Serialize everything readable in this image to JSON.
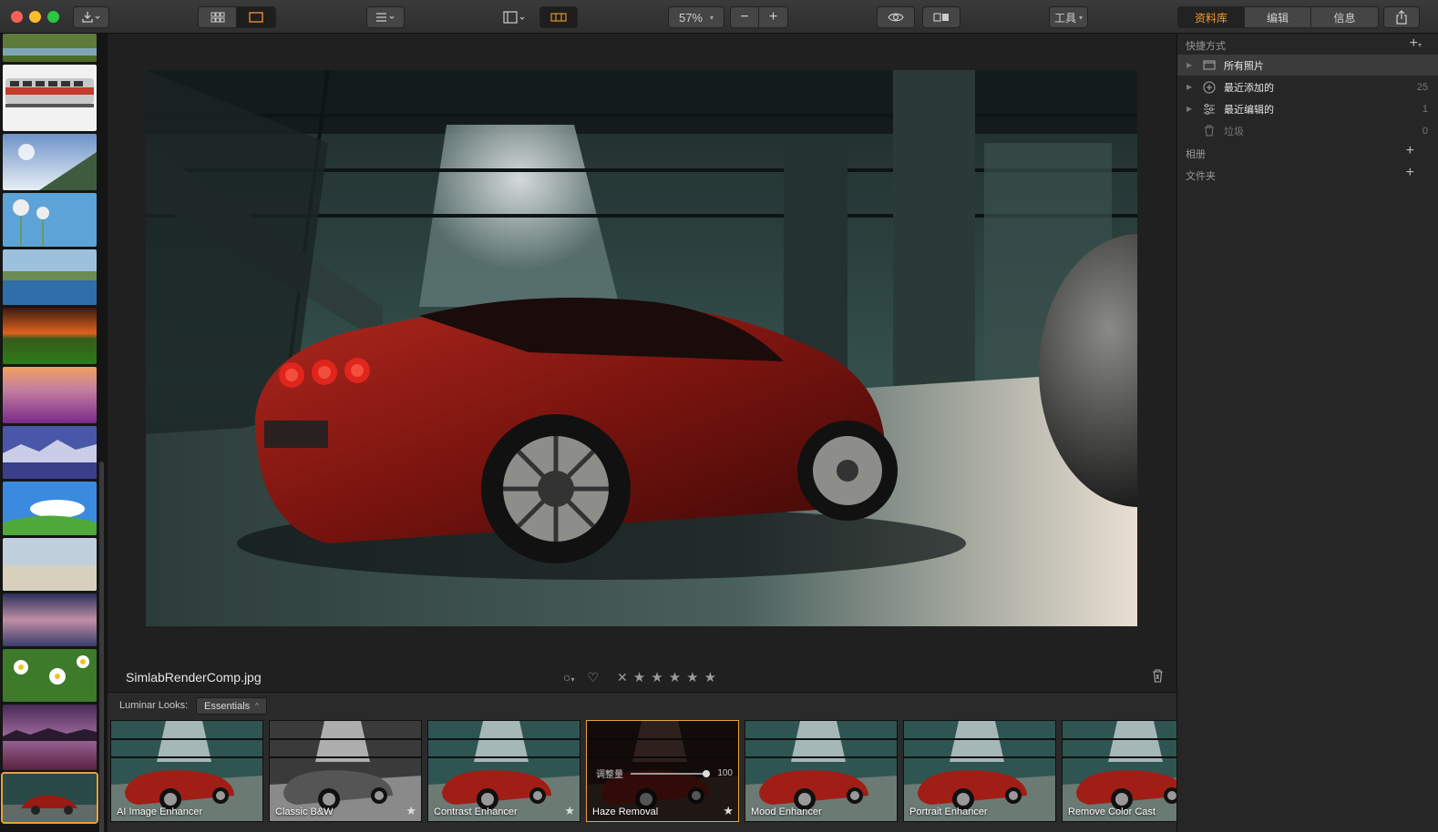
{
  "toolbar": {
    "zoom": "57%",
    "tools_label": "工具",
    "tabs": [
      {
        "label": "资料库",
        "active": true
      },
      {
        "label": "编辑",
        "active": false
      },
      {
        "label": "信息",
        "active": false
      }
    ]
  },
  "sidebar": {
    "shortcuts_header": "快捷方式",
    "items": [
      {
        "label": "所有照片",
        "count": "",
        "selected": true
      },
      {
        "label": "最近添加的",
        "count": "25",
        "selected": false
      },
      {
        "label": "最近编辑的",
        "count": "1",
        "selected": false
      },
      {
        "label": "垃圾",
        "count": "0",
        "selected": false
      }
    ],
    "albums_header": "相册",
    "folders_header": "文件夹"
  },
  "viewer": {
    "filename": "SimlabRenderComp.jpg",
    "rating_stars": 5
  },
  "looks": {
    "label": "Luminar Looks:",
    "category": "Essentials",
    "amount_label": "调整量",
    "amount_value": "100",
    "presets": [
      {
        "label": "AI Image Enhancer",
        "style": "color",
        "selected": false,
        "starred": false
      },
      {
        "label": "Classic B&W",
        "style": "bw",
        "selected": false,
        "starred": true
      },
      {
        "label": "Contrast Enhancer",
        "style": "color",
        "selected": false,
        "starred": true
      },
      {
        "label": "Haze Removal",
        "style": "dark",
        "selected": true,
        "starred": true
      },
      {
        "label": "Mood Enhancer",
        "style": "color",
        "selected": false,
        "starred": false
      },
      {
        "label": "Portrait Enhancer",
        "style": "color",
        "selected": false,
        "starred": false
      },
      {
        "label": "Remove Color Cast",
        "style": "color",
        "selected": false,
        "starred": false
      }
    ]
  },
  "colors": {
    "accent": "#e8a23a",
    "active_tab_text": "#f29a2e"
  }
}
